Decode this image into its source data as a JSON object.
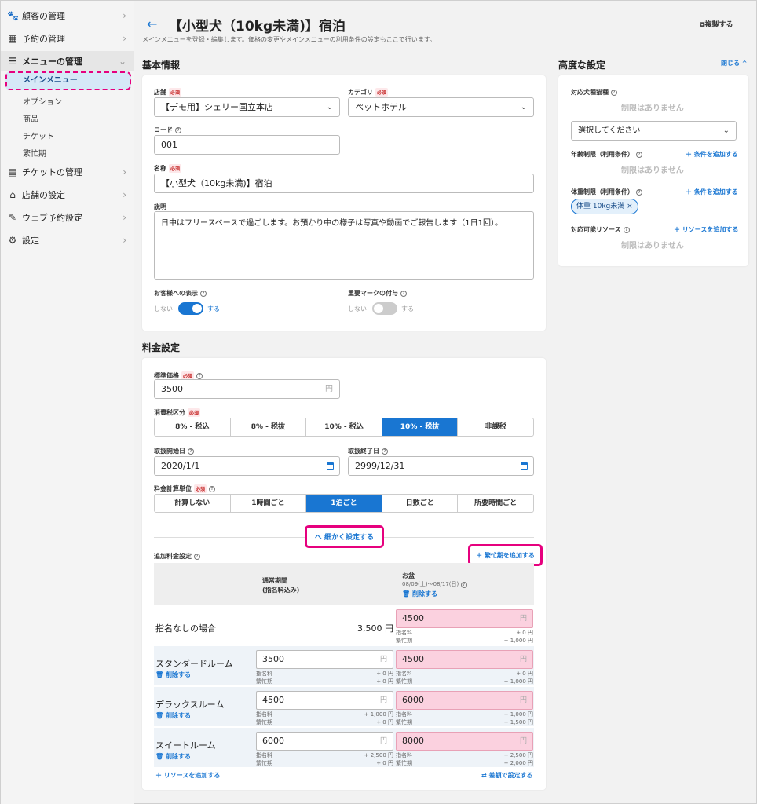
{
  "sidebar": {
    "customers": "顧客の管理",
    "reservations": "予約の管理",
    "menu": "メニューの管理",
    "menu_sub": [
      "メインメニュー",
      "オプション",
      "商品",
      "チケット",
      "繁忙期"
    ],
    "tickets": "チケットの管理",
    "store": "店舗の設定",
    "web": "ウェブ予約設定",
    "settings": "設定"
  },
  "header": {
    "title": "【小型犬（10kg未満)】宿泊",
    "desc": "メインメニューを登録・編集します。価格の変更やメインメニューの利用条件の設定もここで行います。",
    "copy": "複製する"
  },
  "basic": {
    "section": "基本情報",
    "store_label": "店舗",
    "required": "必須",
    "store_value": "【デモ用】シェリー国立本店",
    "category_label": "カテゴリ",
    "category_value": "ペットホテル",
    "code_label": "コード",
    "code_value": "001",
    "name_label": "名称",
    "name_value": "【小型犬（10kg未満)】宿泊",
    "desc_label": "説明",
    "desc_value": "日中はフリースペースで過ごします。お預かり中の様子は写真や動画でご報告します（1日1回）。",
    "display_label": "お客様への表示",
    "important_label": "重要マークの付与",
    "off": "しない",
    "on": "する"
  },
  "pricing": {
    "section": "料金設定",
    "std_label": "標準価格",
    "std_value": "3500",
    "yen": "円",
    "tax_label": "消費税区分",
    "tax_options": [
      "8% - 税込",
      "8% - 税抜",
      "10% - 税込",
      "10% - 税抜",
      "非課税"
    ],
    "start_label": "取扱開始日",
    "start_value": "2020/1/1",
    "end_label": "取扱終了日",
    "end_value": "2999/12/31",
    "unit_label": "料金計算単位",
    "unit_options": [
      "計算しない",
      "1時間ごと",
      "1泊ごと",
      "日数ごと",
      "所要時間ごと"
    ],
    "detail_btn": "へ 細かく設定する",
    "extra_label": "追加料金設定",
    "add_busy": "＋ 繁忙期を追加する",
    "col_normal": "通常期間",
    "col_normal_sub": "(指名料込み)",
    "col_obon": "お盆",
    "col_obon_range": "08/09(土)～08/17(日)",
    "delete": "削除する",
    "nominal": "指名料",
    "busy": "繁忙期",
    "rows": [
      {
        "label": "指名なしの場合",
        "normal_text": "3,500 円",
        "busy_value": "4500",
        "n_fee": "+ 0 円",
        "b_fee": "+ 1,000 円"
      },
      {
        "label": "スタンダードルーム",
        "normal_value": "3500",
        "n1": "+ 0 円",
        "n2": "+ 0 円",
        "busy_value": "4500",
        "b1": "+ 0 円",
        "b2": "+ 1,000 円"
      },
      {
        "label": "デラックスルーム",
        "normal_value": "4500",
        "n1": "+ 1,000 円",
        "n2": "+ 0 円",
        "busy_value": "6000",
        "b1": "+ 1,000 円",
        "b2": "+ 1,500 円"
      },
      {
        "label": "スイートルーム",
        "normal_value": "6000",
        "n1": "+ 2,500 円",
        "n2": "+ 0 円",
        "busy_value": "8000",
        "b1": "+ 2,500 円",
        "b2": "+ 2,000 円"
      }
    ],
    "add_resource": "＋ リソースを追加する",
    "diff_setting": "⇄ 差額で設定する"
  },
  "advanced": {
    "section": "高度な設定",
    "close": "閉じる",
    "breed_label": "対応犬種猫種",
    "no_limit": "制限はありません",
    "select_placeholder": "選択してください",
    "age_label": "年齢制限（利用条件）",
    "add_cond": "＋ 条件を追加する",
    "weight_label": "体重制限（利用条件）",
    "weight_chip": "体重 10kg未満",
    "resource_label": "対応可能リソース",
    "add_res": "＋ リソースを追加する"
  }
}
